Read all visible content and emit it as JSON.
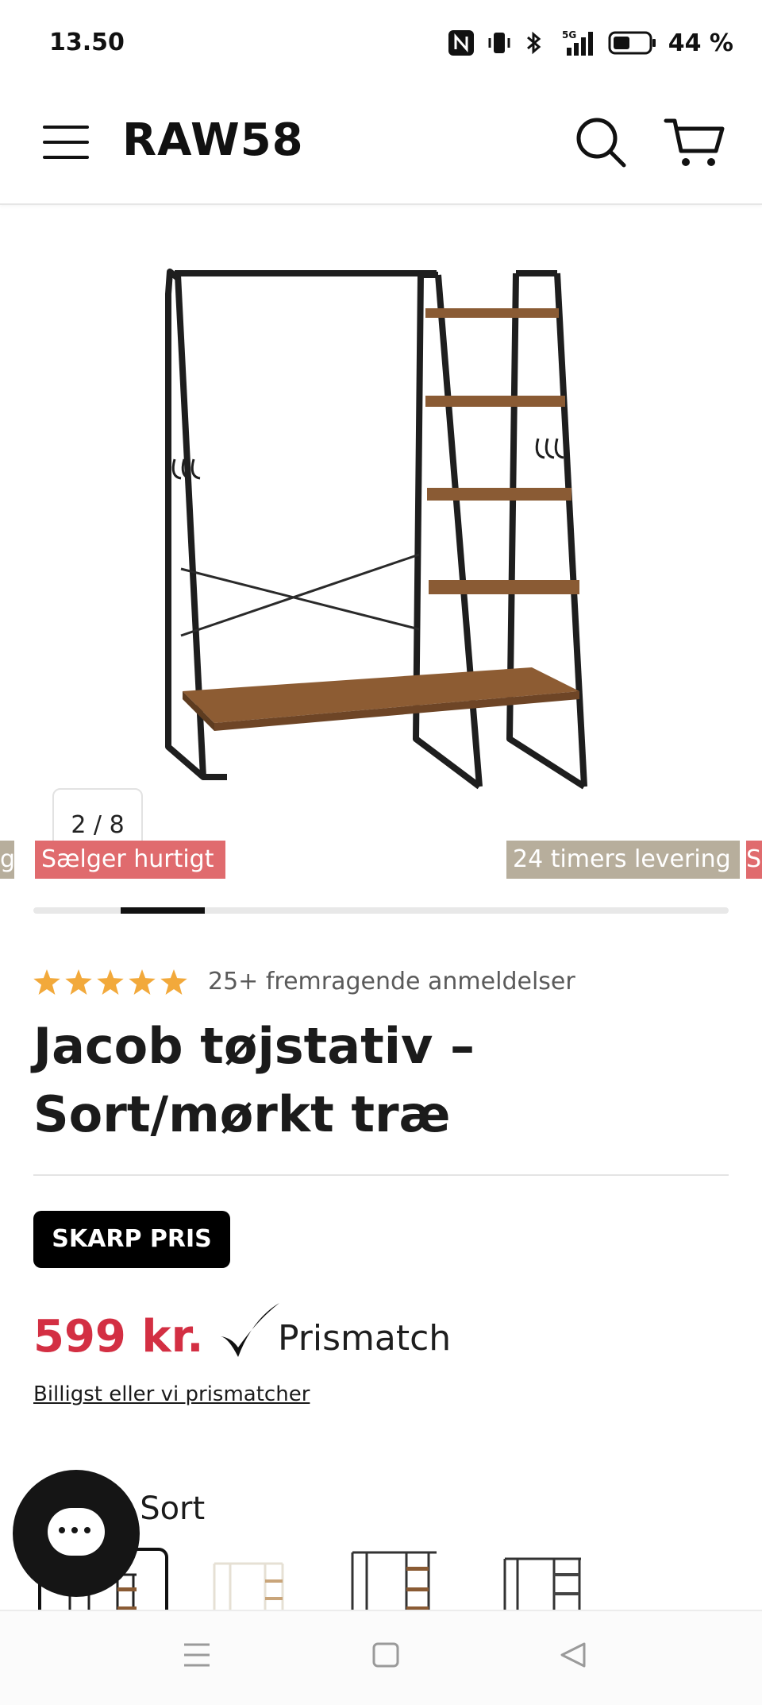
{
  "status_bar": {
    "time": "13.50",
    "network": "5G",
    "battery_percent": "44 %",
    "battery_level": 0.44
  },
  "header": {
    "logo": "RAW58",
    "icons": [
      "menu-icon",
      "search-icon",
      "cart-icon"
    ]
  },
  "gallery": {
    "counter": "2 / 8",
    "current": 2,
    "total": 8
  },
  "badges": {
    "left_edge": "g",
    "sells_fast": "Sælger hurtigt",
    "delivery": "24 timers levering",
    "right_edge": "S"
  },
  "product": {
    "rating_stars": 5,
    "reviews": "25+ fremragende anmeldelser",
    "title": "Jacob tøjstativ – Sort/mørkt træ",
    "sharp_price_label": "SKARP PRIS",
    "price": "599 kr.",
    "price_match": "Prismatch",
    "cheapest_link": "Billigst eller vi prismatcher",
    "color_label": ": Sort"
  },
  "colors": {
    "accent_price": "#d32f43",
    "badge_red": "#e06b6e",
    "badge_beige": "#b7ae9c",
    "star": "#f2a93b"
  },
  "navbar": {
    "icons": [
      "recent-apps-icon",
      "home-icon",
      "back-icon"
    ]
  }
}
